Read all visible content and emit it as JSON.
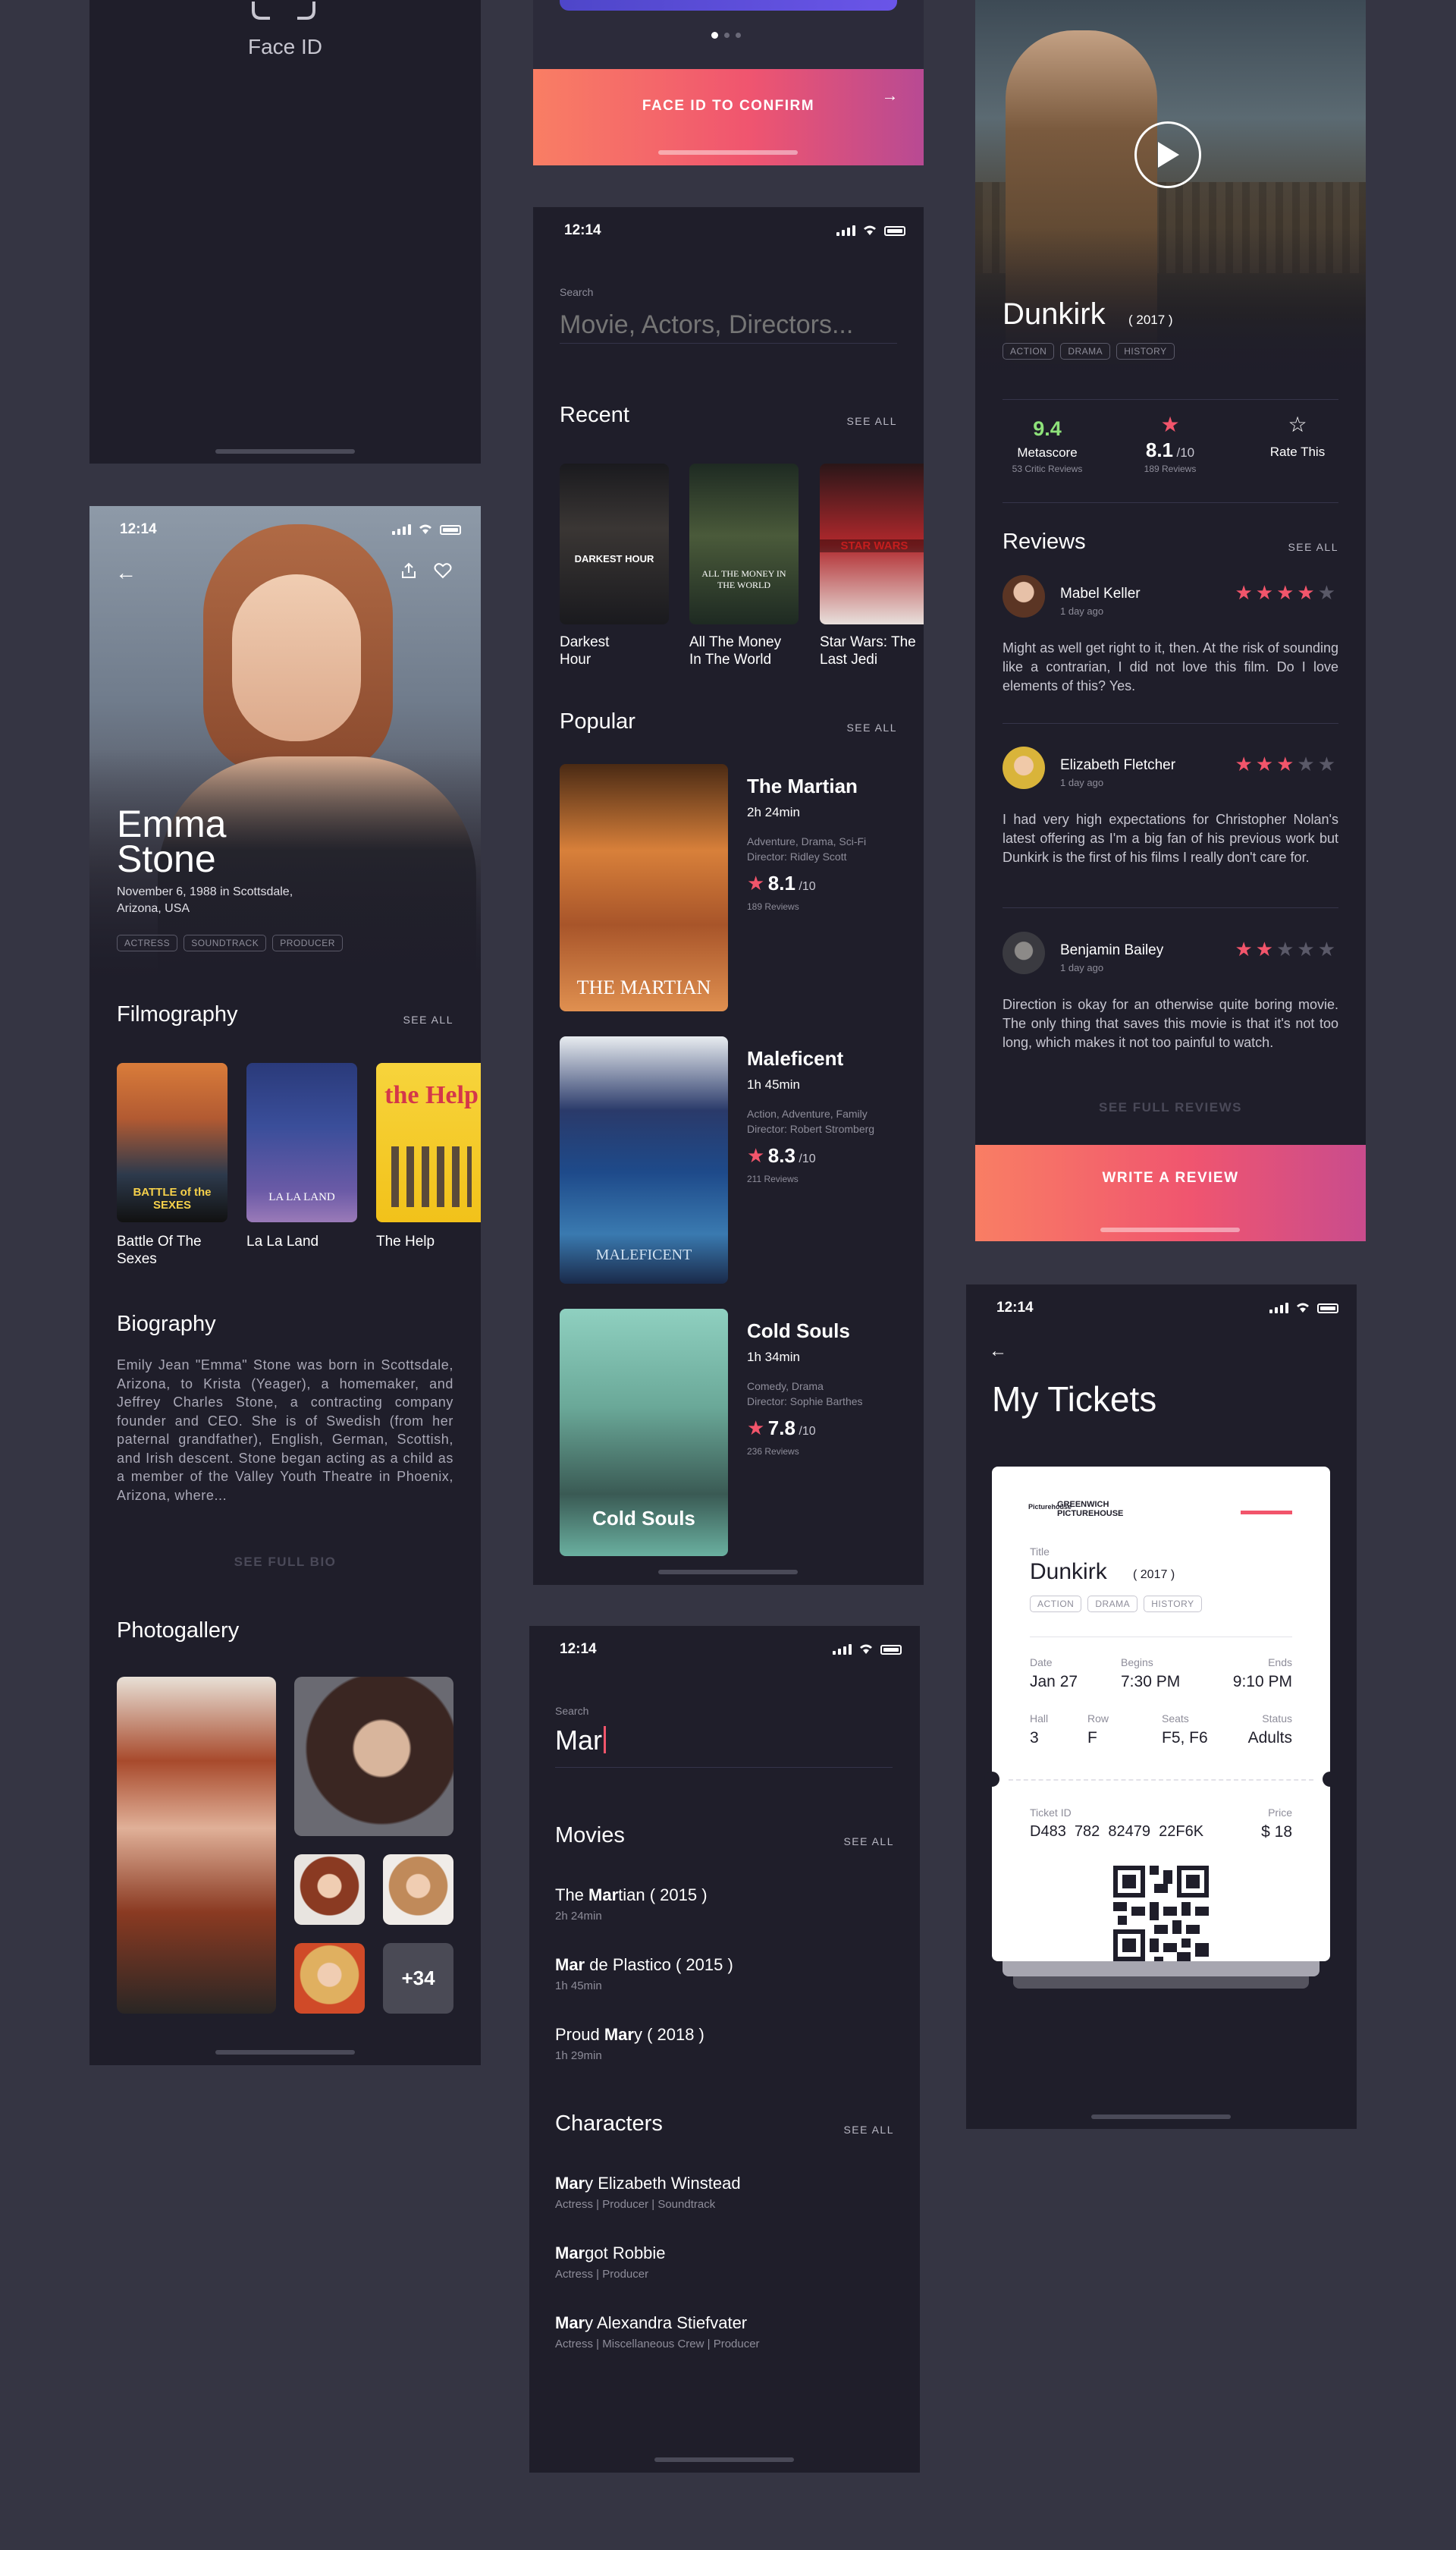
{
  "status_time": "12:14",
  "face_id_screen": {
    "label": "Face ID"
  },
  "confirm_screen": {
    "cta": "FACE ID TO CONFIRM",
    "arrow": "→"
  },
  "actor": {
    "first_name": "Emma",
    "last_name": "Stone",
    "born": "November 6, 1988 in Scottsdale,",
    "born_place": "Arizona, USA",
    "tags": [
      "ACTRESS",
      "SOUNDTRACK",
      "PRODUCER"
    ],
    "filmography_title": "Filmography",
    "see_all": "SEE ALL",
    "films": [
      {
        "line1": "Battle Of The",
        "line2": "Sexes"
      },
      {
        "line1": "La La Land",
        "line2": ""
      },
      {
        "line1": "The Help",
        "line2": ""
      }
    ],
    "biography_title": "Biography",
    "biography": "Emily Jean \"Emma\" Stone was born in Scottsdale, Arizona, to Krista (Yeager), a homemaker, and Jeffrey Charles Stone, a contracting company founder and CEO. She is of Swedish (from her paternal grandfather), English, German, Scottish, and Irish descent. Stone began acting as a child as a member of the Valley Youth Theatre in Phoenix, Arizona, where...",
    "see_full_bio": "SEE FULL BIO",
    "photogallery_title": "Photogallery",
    "more_photos": "+34"
  },
  "browse": {
    "search_label": "Search",
    "search_placeholder": "Movie, Actors, Directors...",
    "recent_title": "Recent",
    "see_all": "SEE ALL",
    "recent": [
      {
        "line1": "Darkest",
        "line2": "Hour",
        "poster_text": "DARKEST HOUR"
      },
      {
        "line1": "All The Money",
        "line2": "In The World",
        "poster_text": "ALL THE MONEY IN THE WORLD"
      },
      {
        "line1": "Star Wars: The",
        "line2": "Last Jedi",
        "poster_text": "STAR WARS"
      }
    ],
    "popular_title": "Popular",
    "popular": [
      {
        "title": "The Martian",
        "duration": "2h 24min",
        "genres": "Adventure, Drama, Sci-Fi",
        "director": "Director: Ridley Scott",
        "rating": "8.1",
        "out_of": "/10",
        "reviews": "189 Reviews",
        "poster_text": "THE MARTIAN"
      },
      {
        "title": "Maleficent",
        "duration": "1h 45min",
        "genres": "Action, Adventure, Family",
        "director": "Director: Robert Stromberg",
        "rating": "8.3",
        "out_of": "/10",
        "reviews": "211 Reviews",
        "poster_text": "MALEFICENT"
      },
      {
        "title": "Cold Souls",
        "duration": "1h 34min",
        "genres": "Comedy, Drama",
        "director": "Director: Sophie Barthes",
        "rating": "7.8",
        "out_of": "/10",
        "reviews": "236 Reviews",
        "poster_text": "Cold Souls"
      }
    ]
  },
  "search": {
    "label": "Search",
    "query": "Mar",
    "movies_title": "Movies",
    "see_all": "SEE ALL",
    "movies": [
      {
        "pre": "The ",
        "match": "Mar",
        "post": "tian ( 2015 )",
        "sub": "2h 24min"
      },
      {
        "pre": "",
        "match": "Mar",
        "post": " de Plastico ( 2015 )",
        "sub": "1h 45min"
      },
      {
        "pre": "Proud ",
        "match": "Mar",
        "post": "y  ( 2018 )",
        "sub": "1h 29min"
      }
    ],
    "characters_title": "Characters",
    "characters": [
      {
        "pre": "",
        "match": "Mar",
        "post": "y Elizabeth Winstead",
        "sub": "Actress | Producer | Soundtrack"
      },
      {
        "pre": "",
        "match": "Mar",
        "post": "got Robbie",
        "sub": "Actress | Producer"
      },
      {
        "pre": "",
        "match": "Mar",
        "post": "y Alexandra Stiefvater",
        "sub": "Actress | Miscellaneous Crew | Producer"
      }
    ]
  },
  "movie": {
    "title": "Dunkirk",
    "year": "( 2017 )",
    "tags": [
      "ACTION",
      "DRAMA",
      "HISTORY"
    ],
    "metascore": "9.4",
    "metascore_label": "Metascore",
    "metascore_sub": "53 Critic Reviews",
    "rating": "8.1",
    "rating_out_of": "/10",
    "rating_sub": "189 Reviews",
    "rate_label": "Rate This",
    "reviews_title": "Reviews",
    "see_all": "SEE ALL",
    "reviews": [
      {
        "name": "Mabel Keller",
        "time": "1 day ago",
        "stars": 4,
        "text": "Might as well get right to it, then. At the risk of sounding like a contrarian, I did not love this film. Do I love elements of this? Yes."
      },
      {
        "name": "Elizabeth Fletcher",
        "time": "1 day ago",
        "stars": 3,
        "text": "I had very high expectations for Christopher Nolan's latest offering as I'm a big fan of his previous work but Dunkirk is the first of his films I really don't care for."
      },
      {
        "name": "Benjamin Bailey",
        "time": "1 day ago",
        "stars": 2,
        "text": "Direction is okay for an otherwise quite boring movie. The only thing that saves this movie is that it's not too long, which makes it not too painful to watch."
      }
    ],
    "see_full_reviews": "SEE FULL REVIEWS",
    "write_review": "WRITE A REVIEW"
  },
  "tickets": {
    "title": "My Tickets",
    "cinema_line1": "GREENWICH",
    "cinema_line2": "PICTUREHOUSE",
    "logo_text": "Picturehouse",
    "title_label": "Title",
    "movie": "Dunkirk",
    "year": "( 2017 )",
    "tags": [
      "ACTION",
      "DRAMA",
      "HISTORY"
    ],
    "date_label": "Date",
    "date": "Jan 27",
    "begins_label": "Begins",
    "begins": "7:30 PM",
    "ends_label": "Ends",
    "ends": "9:10 PM",
    "hall_label": "Hall",
    "hall": "3",
    "row_label": "Row",
    "row": "F",
    "seats_label": "Seats",
    "seats": "F5, F6",
    "status_label": "Status",
    "status": "Adults",
    "ticket_id_label": "Ticket ID",
    "ticket_id": "D483  782  82479  22F6K",
    "price_label": "Price",
    "price": "$ 18"
  },
  "colors": {
    "background": "#353543",
    "screen": "#1f1e2a",
    "accent": "#f2556b",
    "metascore": "#8ee27a"
  }
}
